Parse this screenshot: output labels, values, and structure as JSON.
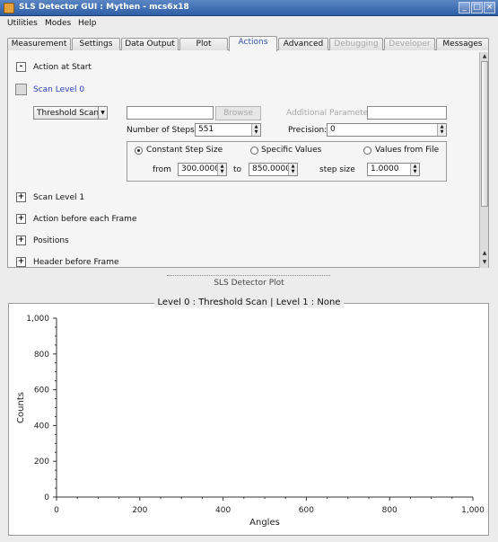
{
  "window": {
    "title": "SLS Detector GUI : Mythen - mcs6x18",
    "minimize": "_",
    "maximize": "□",
    "close": "×"
  },
  "menu": [
    "Utilities",
    "Modes",
    "Help"
  ],
  "tabs": [
    {
      "label": "Measurement",
      "state": "normal"
    },
    {
      "label": "Settings",
      "state": "normal"
    },
    {
      "label": "Data Output",
      "state": "normal"
    },
    {
      "label": "Plot",
      "state": "normal"
    },
    {
      "label": "Actions",
      "state": "active"
    },
    {
      "label": "Advanced",
      "state": "normal"
    },
    {
      "label": "Debugging",
      "state": "disabled"
    },
    {
      "label": "Developer",
      "state": "disabled"
    },
    {
      "label": "Messages",
      "state": "normal"
    }
  ],
  "actions": {
    "action_at_start": {
      "label": "Action at Start",
      "expander": "-"
    },
    "scan_level_0": {
      "label": "Scan Level 0"
    },
    "scan_type": "Threshold Scan",
    "file_field": "",
    "browse": "Browse",
    "additional_params_label": "Additional Parameters",
    "additional_params_value": "",
    "number_of_steps_label": "Number of Steps",
    "number_of_steps": "551",
    "precision_label": "Precision:",
    "precision": "0",
    "mode_constant": "Constant Step Size",
    "mode_specific": "Specific Values",
    "mode_file": "Values from File",
    "selected_mode": "Constant Step Size",
    "from_label": "from",
    "from_value": "300.0000",
    "to_label": "to",
    "to_value": "850.0000",
    "step_label": "step size",
    "step_value": "1.0000",
    "scan_level_1": {
      "label": "Scan Level 1",
      "expander": "+"
    },
    "action_before_frame": {
      "label": "Action before each Frame",
      "expander": "+"
    },
    "positions": {
      "label": "Positions",
      "expander": "+"
    },
    "header_before_frame": {
      "label": "Header before Frame",
      "expander": "+"
    }
  },
  "plot_dock": {
    "title": "SLS Detector Plot"
  },
  "plot": {
    "caption": "Level 0 : Threshold Scan   |   Level 1 : None"
  },
  "chart_data": {
    "type": "line",
    "series": [],
    "xlabel": "Angles",
    "ylabel": "Counts",
    "xlim": [
      0,
      1000
    ],
    "ylim": [
      0,
      1000
    ],
    "xticks": [
      "0",
      "200",
      "400",
      "600",
      "800",
      "1,000"
    ],
    "yticks": [
      "0",
      "200",
      "400",
      "600",
      "800",
      "1,000"
    ],
    "grid": false
  }
}
